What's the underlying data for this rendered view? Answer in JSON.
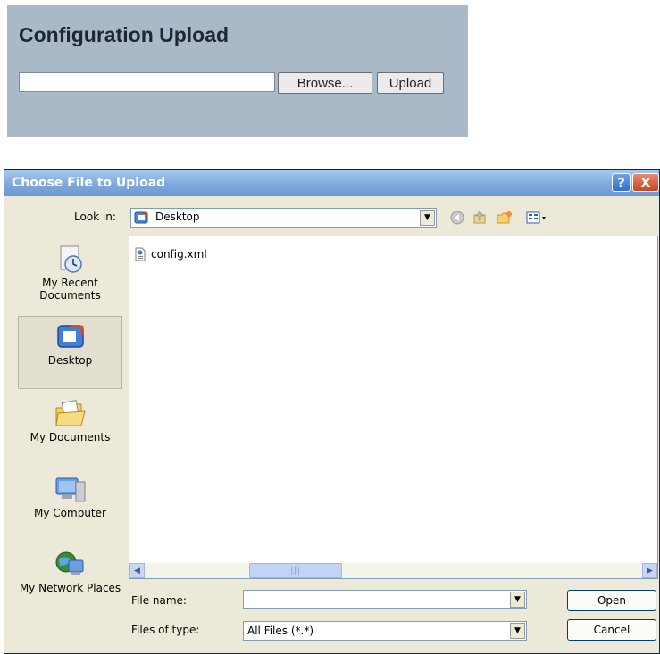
{
  "upload": {
    "title": "Configuration Upload",
    "file_path_value": "",
    "browse_label": "Browse...",
    "upload_label": "Upload"
  },
  "dialog": {
    "title": "Choose File to Upload",
    "help_label": "?",
    "close_label": "X",
    "look_in_label": "Look in:",
    "look_in_value": "Desktop",
    "toolbar_icons": [
      "back-icon",
      "up-folder-icon",
      "new-folder-icon",
      "view-menu-icon"
    ],
    "places": [
      {
        "label": "My Recent Documents",
        "icon": "recent-documents-icon"
      },
      {
        "label": "Desktop",
        "icon": "desktop-icon",
        "selected": true
      },
      {
        "label": "My Documents",
        "icon": "my-documents-icon"
      },
      {
        "label": "My Computer",
        "icon": "my-computer-icon"
      },
      {
        "label": "My Network Places",
        "icon": "network-places-icon"
      }
    ],
    "files": [
      {
        "name": "config.xml",
        "icon": "xml-file-icon"
      }
    ],
    "file_name_label": "File name:",
    "file_name_value": "",
    "files_of_type_label": "Files of type:",
    "files_of_type_value": "All Files (*.*)",
    "open_label": "Open",
    "cancel_label": "Cancel",
    "colors": {
      "titlebar": "#7fa9dc",
      "panel": "#aab9c8",
      "dialog_bg": "#ece9d8"
    }
  }
}
